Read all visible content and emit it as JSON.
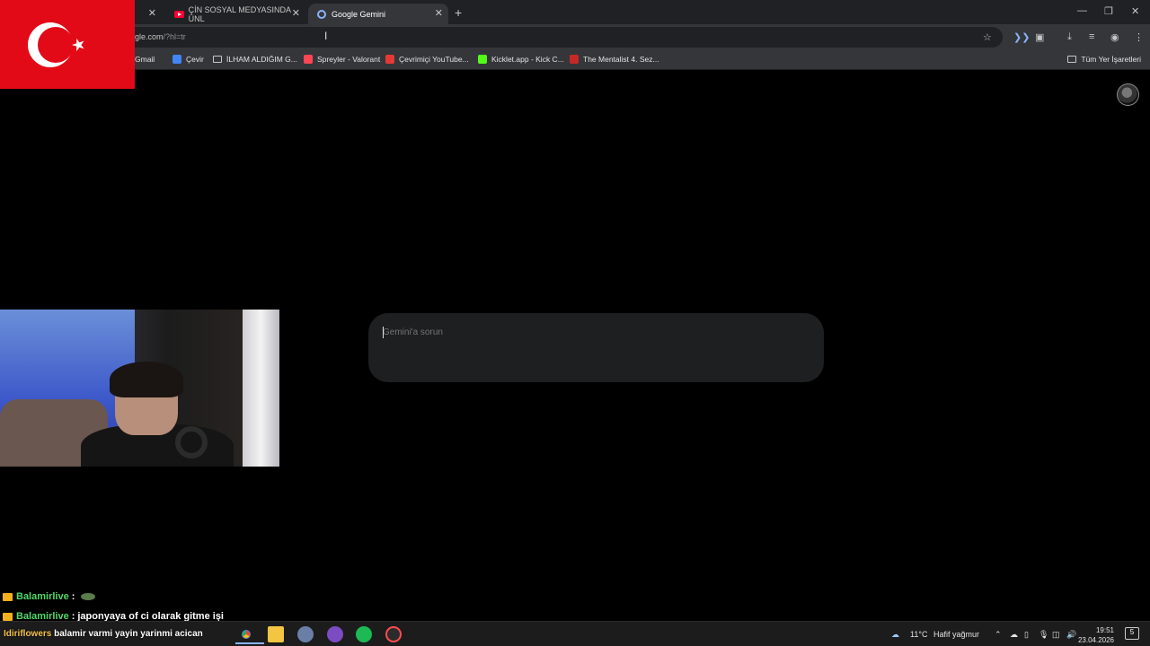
{
  "browser": {
    "tabs": [
      {
        "label": "ÇİN SOSYAL MEDYASINDA ÜNL",
        "icon": "youtube-icon"
      },
      {
        "label": "Google Gemini",
        "icon": "gemini-icon",
        "active": true
      }
    ],
    "new_tab_symbol": "+",
    "close_symbol": "✕",
    "url_host": "gle.com",
    "url_path": "/?hl=tr"
  },
  "bookmarks": {
    "items": [
      {
        "label": "Gmail",
        "color": "#ea4335"
      },
      {
        "label": "Çevir",
        "color": "#4285f4"
      },
      {
        "label": "İLHAM ALDIĞIM G...",
        "color": "folder"
      },
      {
        "label": "Spreyler - Valorant",
        "color": "#ff4655"
      },
      {
        "label": "Çevrimiçi YouTube...",
        "color": "#e53935"
      },
      {
        "label": "Kicklet.app - Kick C...",
        "color": "#53fc18"
      },
      {
        "label": "The Mentalist 4. Sez...",
        "color": "#c62828"
      }
    ],
    "all_bookmarks": "Tüm Yer İşaretleri"
  },
  "gemini": {
    "prompt_placeholder": "Gemini'a sorun"
  },
  "chat": [
    {
      "user": "Balamirlive",
      "message": ""
    },
    {
      "user": "Balamirlive",
      "message": "japonyaya of ci olarak gitme işi"
    }
  ],
  "ticker": {
    "user": "Idiriflowers",
    "message": "balamir varmi yayin yarinmi acican"
  },
  "taskbar": {
    "weather_temp": "11°C",
    "weather_desc": "Hafif yağmur",
    "time": "19:51",
    "date": "23.04.2026",
    "notifications": "5"
  },
  "colors": {
    "accent": "#8ab4f8",
    "flag_red": "#e30a17",
    "chat_user": "#53d769"
  }
}
